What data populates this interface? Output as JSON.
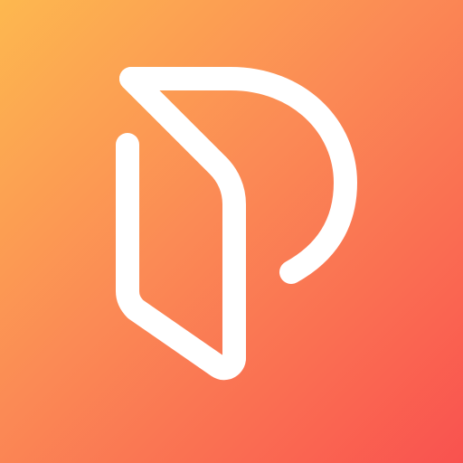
{
  "app_icon": {
    "logo": "stylized-letter-p-logo",
    "colors": {
      "gradient_start": "#FDB84F",
      "gradient_mid": "#FB8A55",
      "gradient_end": "#F9524F",
      "glyph": "#FFFFFF"
    }
  }
}
